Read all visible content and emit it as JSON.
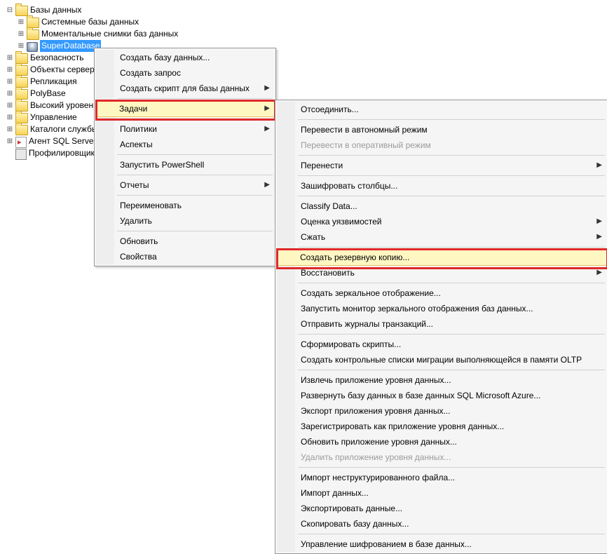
{
  "tree": {
    "root": "Базы данных",
    "children": [
      "Системные базы данных",
      "Моментальные снимки баз данных"
    ],
    "selected_db": "SuperDatabase",
    "siblings": [
      "Безопасность",
      "Объекты сервера",
      "Репликация",
      "PolyBase",
      "Высокий уровень",
      "Управление",
      "Каталоги службы",
      "Агент SQL Server",
      "Профилировщик"
    ]
  },
  "menu1": {
    "items": [
      {
        "label": "Создать базу данных..."
      },
      {
        "label": "Создать запрос"
      },
      {
        "label": "Создать скрипт для базы данных",
        "sub": true
      },
      {
        "sep": true
      },
      {
        "label": "Задачи",
        "sub": true,
        "active": true,
        "redbox": true
      },
      {
        "sep": true
      },
      {
        "label": "Политики",
        "sub": true
      },
      {
        "label": "Аспекты"
      },
      {
        "sep": true
      },
      {
        "label": "Запустить PowerShell"
      },
      {
        "sep": true
      },
      {
        "label": "Отчеты",
        "sub": true
      },
      {
        "sep": true
      },
      {
        "label": "Переименовать"
      },
      {
        "label": "Удалить"
      },
      {
        "sep": true
      },
      {
        "label": "Обновить"
      },
      {
        "label": "Свойства"
      }
    ]
  },
  "menu2": {
    "items": [
      {
        "label": "Отсоединить..."
      },
      {
        "sep": true
      },
      {
        "label": "Перевести в автономный режим"
      },
      {
        "label": "Перевести в оперативный режим",
        "disabled": true
      },
      {
        "sep": true
      },
      {
        "label": "Перенести",
        "sub": true
      },
      {
        "sep": true
      },
      {
        "label": "Зашифровать столбцы..."
      },
      {
        "sep": true
      },
      {
        "label": "Classify Data..."
      },
      {
        "label": "Оценка уязвимостей",
        "sub": true
      },
      {
        "label": "Сжать",
        "sub": true
      },
      {
        "sep": true
      },
      {
        "label": "Создать резервную копию...",
        "active": true,
        "redbox": true
      },
      {
        "label": "Восстановить",
        "sub": true
      },
      {
        "sep": true
      },
      {
        "label": "Создать зеркальное отображение..."
      },
      {
        "label": "Запустить монитор зеркального отображения баз данных..."
      },
      {
        "label": "Отправить журналы транзакций..."
      },
      {
        "sep": true
      },
      {
        "label": "Сформировать скрипты..."
      },
      {
        "label": "Создать контрольные списки миграции выполняющейся в памяти OLTP"
      },
      {
        "sep": true
      },
      {
        "label": "Извлечь приложение уровня данных..."
      },
      {
        "label": "Развернуть базу данных в базе данных SQL Microsoft Azure..."
      },
      {
        "label": "Экспорт приложения уровня данных..."
      },
      {
        "label": "Зарегистрировать как приложение уровня данных..."
      },
      {
        "label": "Обновить приложение уровня данных..."
      },
      {
        "label": "Удалить приложение уровня данных...",
        "disabled": true
      },
      {
        "sep": true
      },
      {
        "label": "Импорт неструктурированного файла..."
      },
      {
        "label": "Импорт данных..."
      },
      {
        "label": "Экспортировать данные..."
      },
      {
        "label": "Скопировать базу данных..."
      },
      {
        "sep": true
      },
      {
        "label": "Управление шифрованием в базе данных..."
      }
    ]
  }
}
